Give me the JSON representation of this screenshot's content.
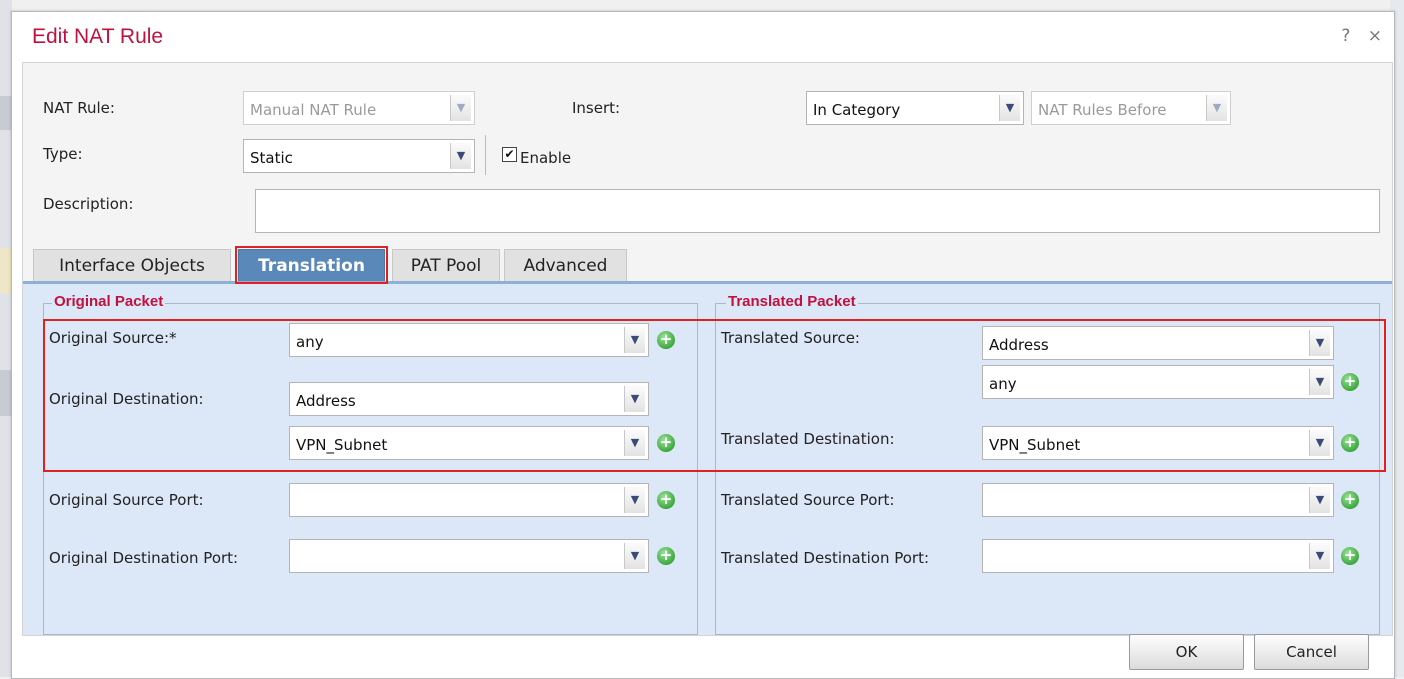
{
  "dialog": {
    "title": "Edit NAT Rule",
    "help_icon": "?",
    "close_icon": "×"
  },
  "form": {
    "nat_rule_label": "NAT Rule:",
    "nat_rule_value": "Manual NAT Rule",
    "insert_label": "Insert:",
    "insert_value": "In Category",
    "insert_position_value": "NAT Rules Before",
    "type_label": "Type:",
    "type_value": "Static",
    "enable_label": "Enable",
    "enable_checked": true,
    "description_label": "Description:",
    "description_value": ""
  },
  "tabs": [
    {
      "label": "Interface Objects",
      "active": false
    },
    {
      "label": "Translation",
      "active": true
    },
    {
      "label": "PAT Pool",
      "active": false
    },
    {
      "label": "Advanced",
      "active": false
    }
  ],
  "original_packet": {
    "legend": "Original Packet",
    "source_label": "Original Source:*",
    "source_value": "any",
    "destination_label": "Original Destination:",
    "destination_type": "Address",
    "destination_value": "VPN_Subnet",
    "source_port_label": "Original Source Port:",
    "source_port_value": "",
    "destination_port_label": "Original Destination Port:",
    "destination_port_value": ""
  },
  "translated_packet": {
    "legend": "Translated Packet",
    "source_label": "Translated Source:",
    "source_type": "Address",
    "source_value": "any",
    "destination_label": "Translated Destination:",
    "destination_value": "VPN_Subnet",
    "source_port_label": "Translated Source Port:",
    "source_port_value": "",
    "destination_port_label": "Translated Destination Port:",
    "destination_port_value": ""
  },
  "buttons": {
    "ok": "OK",
    "cancel": "Cancel"
  },
  "colors": {
    "title": "#c0123e",
    "active_tab": "#5a88b8",
    "panel_bg": "#dce7f7",
    "highlight": "#e0221e"
  },
  "icons": {
    "dropdown": "chevron-down-icon",
    "add": "add-circle-icon",
    "checkbox": "checkmark-icon"
  }
}
